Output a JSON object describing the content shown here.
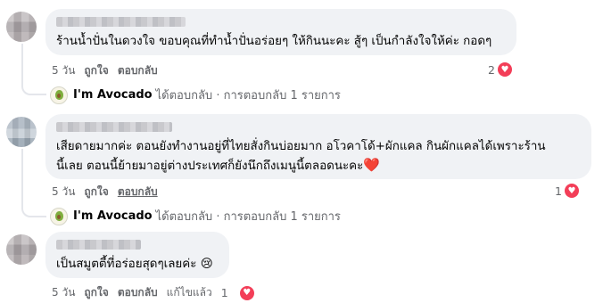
{
  "comments": [
    {
      "text": "ร้านน้ำปั่นในดวงใจ ขอบคุณที่ทำน้ำปั่นอร่อยๆ ให้กินนะคะ สู้ๆ เป็นกำลังใจให้ค่ะ กอดๆ",
      "time": "5 วัน",
      "like": "ถูกใจ",
      "reply": "ตอบกลับ",
      "react_count": "2",
      "reply_summary": {
        "page_name": "I'm Avocado",
        "text": "ได้ตอบกลับ · การตอบกลับ 1 รายการ"
      }
    },
    {
      "text_line1": "เสียดายมากค่ะ ตอนยังทำงานอยู่ที่ไทยสั่งกินบ่อยมาก อโวคาโด้+ผักแคล กินผักแคลได้เพราะร้าน",
      "text_line2": "นี้เลย ตอนนี้ย้ายมาอยู่ต่างประเทศก็ยังนึกถึงเมนูนี้ตลอดนะคะ",
      "heart_emoji": "❤️",
      "time": "5 วัน",
      "like": "ถูกใจ",
      "reply": "ตอบกลับ",
      "react_count": "1",
      "reply_summary": {
        "page_name": "I'm Avocado",
        "text": "ได้ตอบกลับ · การตอบกลับ 1 รายการ"
      }
    },
    {
      "text": "เป็นสมูตตี้ที่อร่อยสุดๆเลยค่ะ",
      "emoji": "😢",
      "time": "5 วัน",
      "like": "ถูกใจ",
      "reply": "ตอบกลับ",
      "edited": "แก้ไขแล้ว",
      "react_count": "1"
    }
  ],
  "icons": {
    "reaction": "heart-reaction-icon",
    "page_avatar": "avocado-logo-icon"
  },
  "colors": {
    "bubble": "#f0f2f5",
    "meta": "#65676b",
    "heart": "#f33e58"
  }
}
